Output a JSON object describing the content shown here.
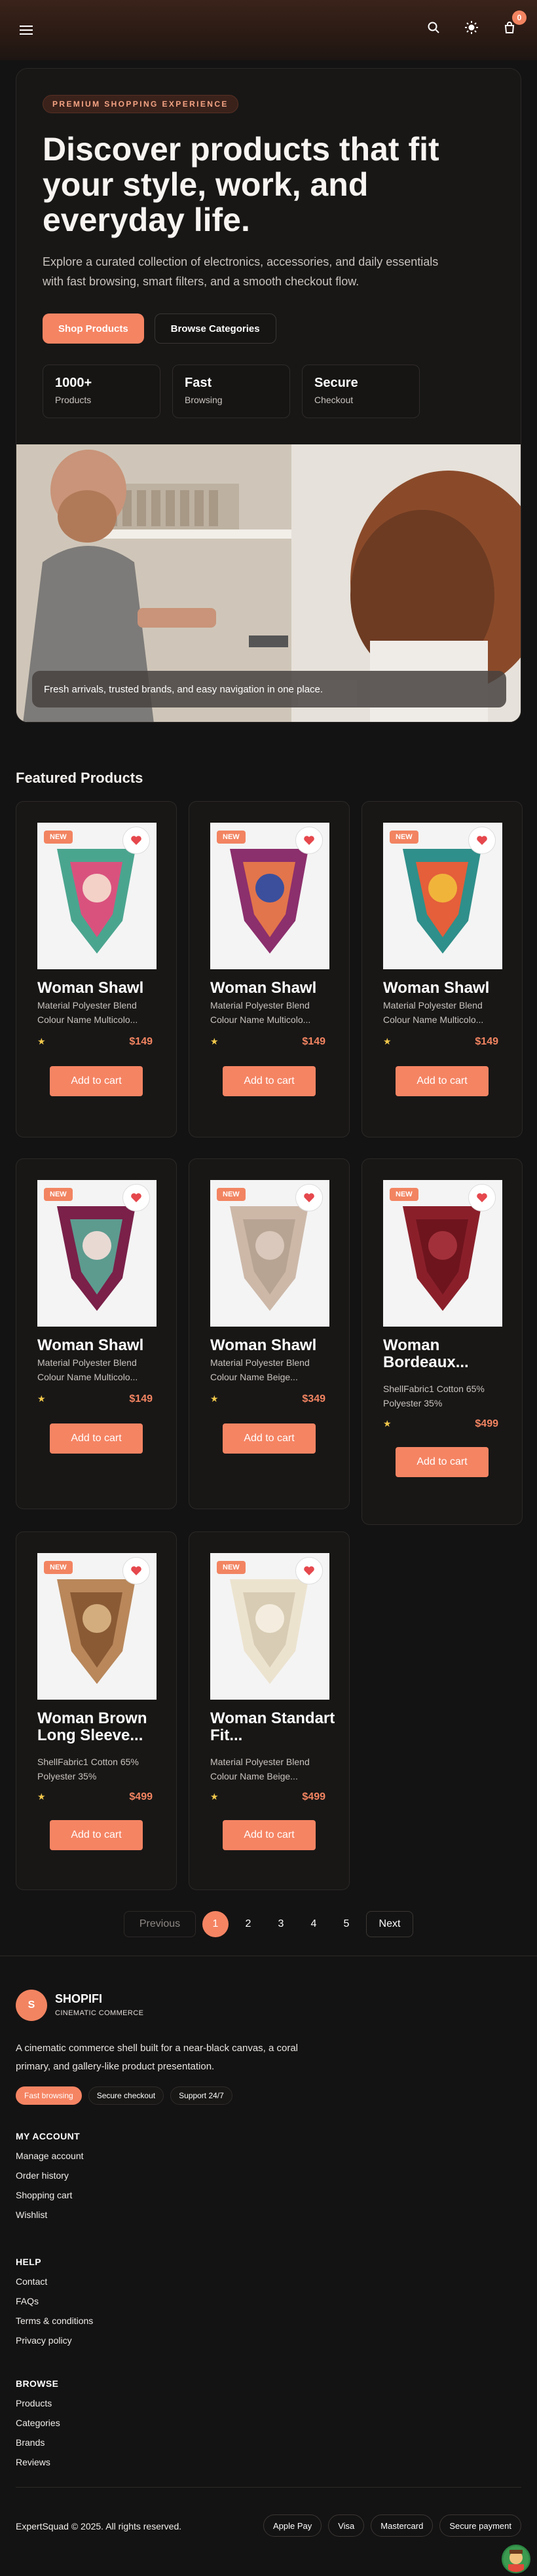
{
  "header": {
    "cart_count": "0",
    "icons": [
      "menu-icon",
      "search-icon",
      "sun-icon",
      "bag-icon"
    ]
  },
  "hero": {
    "eyebrow": "PREMIUM SHOPPING EXPERIENCE",
    "title": "Discover products that fit your style, work, and everyday life.",
    "description": "Explore a curated collection of electronics, accessories, and daily essentials with fast browsing, smart filters, and a smooth checkout flow.",
    "primary_button": "Shop Products",
    "secondary_button": "Browse Categories",
    "stats": [
      {
        "value": "1000+",
        "label": "Products"
      },
      {
        "value": "Fast",
        "label": "Browsing"
      },
      {
        "value": "Secure",
        "label": "Checkout"
      }
    ],
    "caption": "Fresh arrivals, trusted brands, and easy navigation in one place."
  },
  "featured": {
    "title": "Featured Products",
    "badge": "NEW",
    "add_label": "Add to cart",
    "rating_symbol": "★",
    "products": [
      {
        "title": "Woman Shawl",
        "desc": "Material Polyester Blend Colour Name Multicolo...",
        "price": "$149"
      },
      {
        "title": "Woman Shawl",
        "desc": "Material Polyester Blend Colour Name Multicolo...",
        "price": "$149"
      },
      {
        "title": "Woman Shawl",
        "desc": "Material Polyester Blend Colour Name Multicolo...",
        "price": "$149"
      },
      {
        "title": "Woman Shawl",
        "desc": "Material Polyester Blend Colour Name Multicolo...",
        "price": "$149"
      },
      {
        "title": "Woman Shawl",
        "desc": "Material Polyester Blend Colour Name Beige...",
        "price": "$349"
      },
      {
        "title": "Woman Bordeaux...",
        "desc": "ShellFabric1 Cotton 65% Polyester 35%",
        "price": "$499"
      },
      {
        "title": "Woman Brown Long Sleeve...",
        "desc": "ShellFabric1 Cotton 65% Polyester 35%",
        "price": "$499"
      },
      {
        "title": "Woman Standart Fit...",
        "desc": "Material Polyester Blend Colour Name Beige...",
        "price": "$499"
      }
    ]
  },
  "pagination": {
    "prev": "Previous",
    "next": "Next",
    "pages": [
      "1",
      "2",
      "3",
      "4",
      "5"
    ],
    "current": "1"
  },
  "footer": {
    "logo_letter": "S",
    "brand": "SHOPIFI",
    "tagline": "CINEMATIC COMMERCE",
    "description": "A cinematic commerce shell built for a near-black canvas, a coral primary, and gallery-like product presentation.",
    "chips": [
      "Fast browsing",
      "Secure checkout",
      "Support 24/7"
    ],
    "sections": [
      {
        "title": "MY ACCOUNT",
        "links": [
          "Manage account",
          "Order history",
          "Shopping cart",
          "Wishlist"
        ]
      },
      {
        "title": "HELP",
        "links": [
          "Contact",
          "FAQs",
          "Terms & conditions",
          "Privacy policy"
        ]
      },
      {
        "title": "BROWSE",
        "links": [
          "Products",
          "Categories",
          "Brands",
          "Reviews"
        ]
      }
    ],
    "copyright": "ExpertSquad © 2025. All rights reserved.",
    "payments": [
      "Apple Pay",
      "Visa",
      "Mastercard",
      "Secure payment"
    ]
  },
  "colors": {
    "accent": "#f58463",
    "background": "#141313",
    "card": "#181716",
    "star": "#f2c84b"
  }
}
